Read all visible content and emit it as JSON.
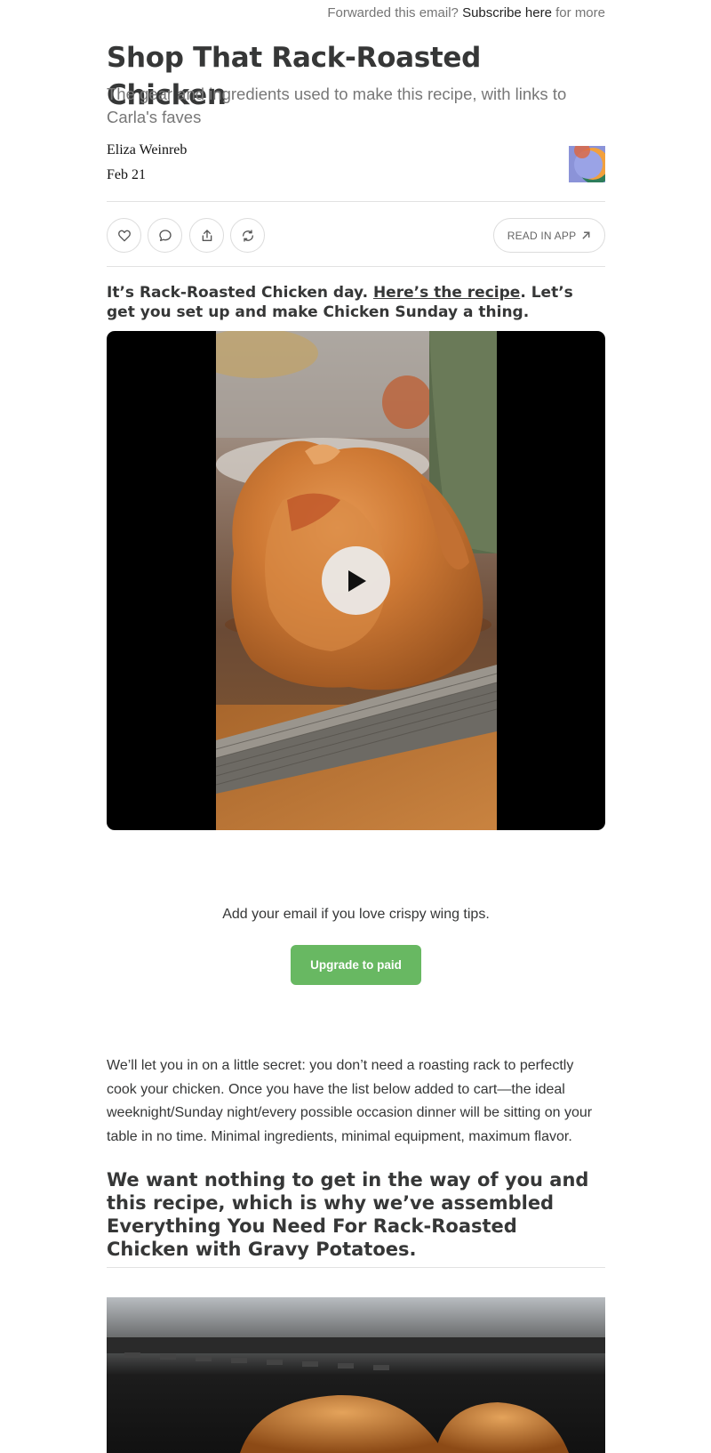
{
  "forward_bar": {
    "prefix": "Forwarded this email?",
    "link": "Subscribe here",
    "suffix": "for more"
  },
  "post": {
    "title": "Shop That Rack-Roasted Chicken",
    "subtitle": "The gear and ingredients used to make this recipe, with links to Carla's faves",
    "author": "Eliza Weinreb",
    "date": "Feb 21"
  },
  "actions": {
    "like_icon": "heart-icon",
    "comment_icon": "comment-icon",
    "share_icon": "share-icon",
    "restack_icon": "restack-icon",
    "read_in_app": "READ IN APP"
  },
  "intro": {
    "lead": "It’s Rack-Roasted Chicken day.",
    "link": "Here’s the recipe",
    "tail": ". Let’s get you set up and make Chicken Sunday a thing."
  },
  "video": {
    "play_icon": "play-icon"
  },
  "cta": {
    "text": "Add your email if you love crispy wing tips.",
    "button": "Upgrade to paid",
    "button_color": "#68b862"
  },
  "body": {
    "paragraph": "We’ll let you in on a little secret: you don’t need a roasting rack to perfectly cook your chicken. Once you have the list below added to cart—the ideal weeknight/Sunday night/every possible occasion dinner will be sitting on your table in no time. Minimal ingredients, minimal equipment, maximum flavor.",
    "heading": "We want nothing to get in the way of you and this recipe, which is why we’ve assembled Everything You Need For Rack-Roasted Chicken with Gravy Potatoes."
  }
}
